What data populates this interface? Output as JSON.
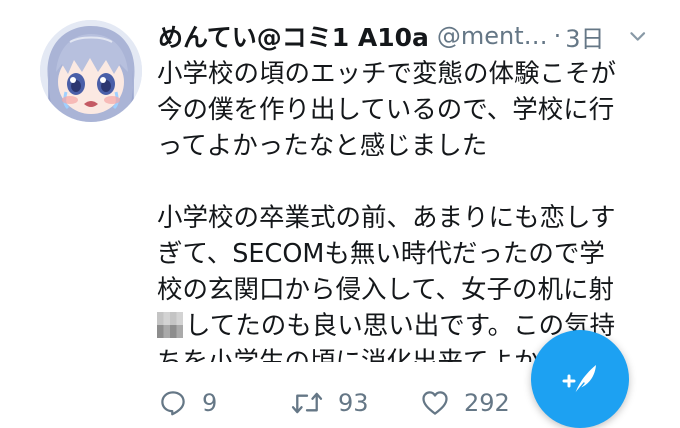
{
  "tweet": {
    "display_name": "めんてい@コミ1 A10a",
    "handle": "@ment…",
    "separator": "·",
    "time": "3日",
    "lines": [
      "小学校の頃のエッチで変態の体験こそが",
      "今の僕を作り出しているので、学校に行",
      "ってよかったなと感じました",
      "",
      "小学校の卒業式の前、あまりにも恋しす",
      "ぎて、SECOMも無い時代だったので学",
      "校の玄関口から侵入して、女子の机に射",
      "してたのも良い思い出です。この気持",
      "ちを小学生の頃に消化出来てよか"
    ],
    "counts": {
      "replies": "9",
      "retweets": "93",
      "likes": "292"
    }
  },
  "icons": {
    "reply": "reply-icon",
    "retweet": "retweet-icon",
    "like": "heart-icon",
    "caret": "chevron-down-icon",
    "compose": "compose-icon"
  },
  "colors": {
    "accent": "#1da1f2",
    "secondary_text": "#657786",
    "primary_text": "#14171a"
  }
}
